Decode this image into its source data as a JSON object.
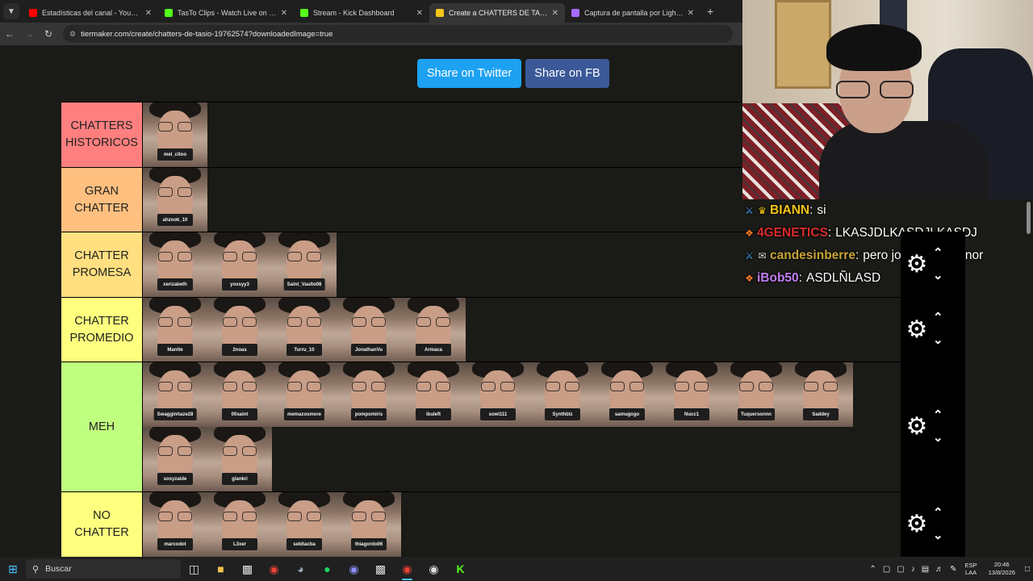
{
  "browser": {
    "tab_list_icon": "chevron-down-icon",
    "tabs": [
      {
        "title": "Estadísticas del canal - YouTube",
        "color": "#ff0000",
        "active": false
      },
      {
        "title": "TasTo Clips - Watch Live on Kick",
        "color": "#53fc18",
        "active": false
      },
      {
        "title": "Stream - Kick Dashboard",
        "color": "#53fc18",
        "active": false
      },
      {
        "title": "Create a CHATTERS DE TASIO Tier List",
        "color": "#f5c518",
        "active": true
      },
      {
        "title": "Captura de pantalla por Lightshot",
        "color": "#a86bff",
        "active": false
      }
    ],
    "new_tab": "+",
    "url": "tiermaker.com/create/chatters-de-tasio-19762574?downloadedImage=true"
  },
  "page": {
    "share_twitter": "Share on Twitter",
    "share_fb": "Share on FB",
    "tiers": [
      {
        "label": "CHATTERS HISTORICOS",
        "color": "#ff7f7f",
        "items": [
          "mel_citoo"
        ]
      },
      {
        "label": "GRAN CHATTER",
        "color": "#ffbf7f",
        "items": [
          "ahzook_10"
        ]
      },
      {
        "label": "CHATTER PROMESA",
        "color": "#ffdf7f",
        "items": [
          "xerizabeth",
          "yossyy3",
          "Saint_Vaulto08"
        ]
      },
      {
        "label": "CHATTER PROMEDIO",
        "color": "#ffff7f",
        "items": [
          "Mantte",
          "2noas",
          "Turru_10",
          "JonathanVu",
          "Armaca"
        ]
      },
      {
        "label": "MEH",
        "color": "#bfff7f",
        "items": [
          "Swagginhaze28",
          "00saint",
          "memazosmore",
          "pompomiris",
          "ibuleft",
          "sowi111",
          "Synthblz",
          "samugogo",
          "Nucc1",
          "Tuquersonnn",
          "Saddey",
          "sosyzaide",
          "glankri"
        ]
      },
      {
        "label": "NO CHATTER",
        "color": "#ffff7f",
        "items": [
          "marcodot",
          "L3xer",
          "sebitacba",
          "thiagordo06"
        ]
      }
    ]
  },
  "chat": [
    {
      "badges": [
        "sword-icon",
        "crown-icon"
      ],
      "user": "BIANN",
      "user_color": "#f5c518",
      "text": "si"
    },
    {
      "badges": [
        "gift-icon"
      ],
      "user": "4GENETICS",
      "user_color": "#d92b2b",
      "text": "LKASJDLKASDJLKASDJ"
    },
    {
      "badges": [
        "sword-icon",
        "envelope-icon"
      ],
      "user": "candesinberre",
      "user_color": "#c9a43a",
      "text": "pero jowi es re menor"
    },
    {
      "badges": [
        "gift-icon"
      ],
      "user": "iBob50",
      "user_color": "#c27ef0",
      "text": "ASDLÑLASD"
    }
  ],
  "taskbar": {
    "search_placeholder": "Buscar",
    "lang_line1": "ESP",
    "lang_line2": "LAA",
    "time": "20:46",
    "date": "13/8/2026"
  }
}
